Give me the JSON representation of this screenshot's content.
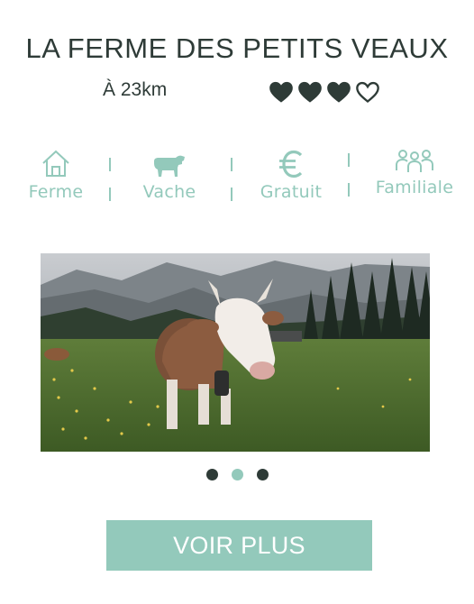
{
  "farm": {
    "title": "LA FERME DES PETITS VEAUX",
    "distance": "À 23km",
    "rating": {
      "value": 3,
      "max": 5,
      "filled_icon": "heart-filled-icon",
      "empty_icon": "heart-outline-icon"
    }
  },
  "features": [
    {
      "label": "Ferme",
      "icon": "house-icon"
    },
    {
      "label": "Vache",
      "icon": "cow-icon"
    },
    {
      "label": "Gratuit",
      "icon": "euro-icon"
    },
    {
      "label": "Familiale",
      "icon": "family-icon"
    }
  ],
  "carousel": {
    "total": 3,
    "active_index": 1,
    "image_alt": "cow-in-alpine-meadow-photo"
  },
  "cta": {
    "label": "VOIR PLUS"
  },
  "colors": {
    "accent": "#93c9bb",
    "text": "#2e3b37",
    "background": "#ffffff"
  }
}
